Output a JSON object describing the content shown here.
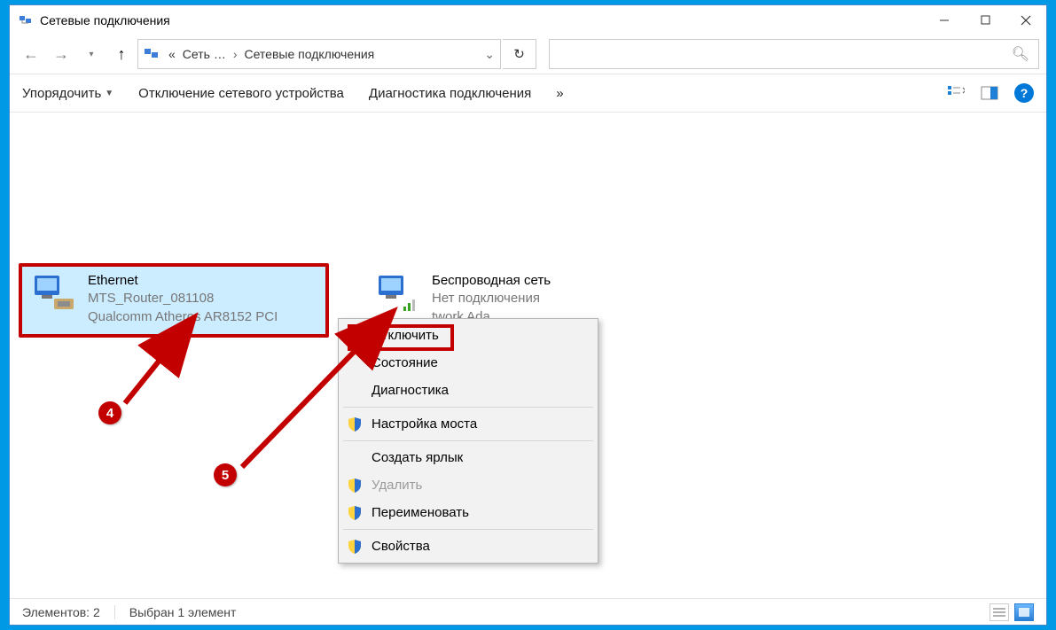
{
  "window": {
    "title": "Сетевые подключения"
  },
  "breadcrumb": {
    "root": "Сеть …",
    "current": "Сетевые подключения"
  },
  "toolbar": {
    "organize": "Упорядочить",
    "disable_device": "Отключение сетевого устройства",
    "diagnose": "Диагностика подключения",
    "overflow": "»"
  },
  "connections": {
    "ethernet": {
      "name": "Ethernet",
      "network": "MTS_Router_081108",
      "adapter": "Qualcomm Atheros AR8152 PCI"
    },
    "wifi": {
      "name": "Беспроводная сеть",
      "status": "Нет подключения",
      "adapter_trunc": "twork Ada..."
    }
  },
  "context_menu": {
    "disable": "Отключить",
    "status": "Состояние",
    "diagnose": "Диагностика",
    "bridge": "Настройка моста",
    "shortcut": "Создать ярлык",
    "delete": "Удалить",
    "rename": "Переименовать",
    "properties": "Свойства"
  },
  "callouts": {
    "four": "4",
    "five": "5"
  },
  "statusbar": {
    "count": "Элементов: 2",
    "selected": "Выбран 1 элемент"
  },
  "help_glyph": "?"
}
